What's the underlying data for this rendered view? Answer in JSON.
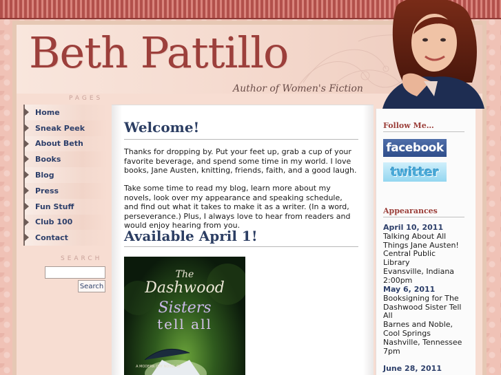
{
  "site": {
    "title": "Beth Pattillo",
    "tagline": "Author of Women's Fiction"
  },
  "sidebar": {
    "pages_heading": "PAGES",
    "items": [
      {
        "label": "Home"
      },
      {
        "label": "Sneak Peek"
      },
      {
        "label": "About Beth"
      },
      {
        "label": "Books"
      },
      {
        "label": "Blog"
      },
      {
        "label": "Press"
      },
      {
        "label": "Fun Stuff"
      },
      {
        "label": "Club 100"
      },
      {
        "label": "Contact"
      }
    ],
    "search_heading": "SEARCH",
    "search_value": "",
    "search_button": "Search"
  },
  "main": {
    "welcome_heading": "Welcome!",
    "para1": "Thanks for dropping by. Put your feet up, grab a cup of your favorite beverage, and spend some time in my world. I love books, Jane Austen, knitting, friends, faith, and a good laugh.",
    "para2": "Take some time to read my blog, learn more about my novels, look over my appearance and speaking schedule, and find out what it takes to make it as a writer. (In a word, perseverance.) Plus, I always love to hear from readers and would enjoy hearing from you.",
    "available_heading": "Available April 1!",
    "book_cover": {
      "line1": "The",
      "line2": "Dashwood",
      "line3": "Sisters",
      "line4": "tell all",
      "strap": "A MODERN DAY NOVEL OF"
    }
  },
  "rightbar": {
    "follow_heading": "Follow Me…",
    "facebook_label": "facebook",
    "twitter_label": "twitter",
    "appearances_heading": "Appearances",
    "events": [
      {
        "date": "April 10, 2011",
        "lines": [
          "Talking About All Things Jane Austen!",
          "Central Public Library",
          "Evansville, Indiana",
          "2:00pm"
        ]
      },
      {
        "date": "May 6, 2011",
        "lines": [
          "Booksigning for The Dashwood Sister Tell All",
          "Barnes and Noble, Cool Springs",
          "Nashville, Tennessee",
          "7pm"
        ]
      },
      {
        "date": "June 28, 2011",
        "lines": []
      }
    ]
  },
  "colors": {
    "brand_red": "#9c3f3b",
    "link_navy": "#2d3f6a",
    "stripe": "#b2504b"
  }
}
